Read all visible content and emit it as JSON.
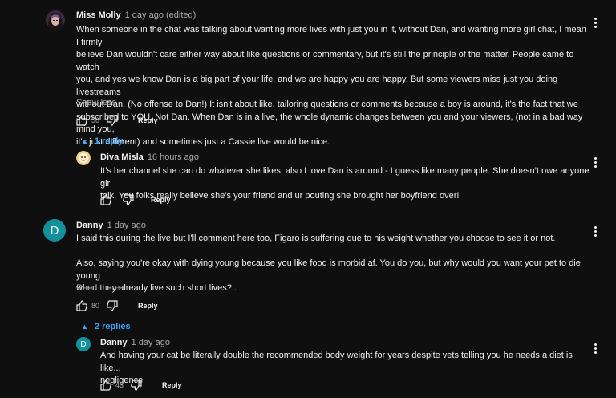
{
  "comments": [
    {
      "author": "Miss Molly",
      "time": "1 day ago (edited)",
      "text_lines": [
        "When someone in the chat was talking about wanting more lives with just you in it, without Dan, and wanting more girl chat, I mean I firmly",
        "believe Dan wouldn't care either way about like questions or commentary, but it's still the principle of the matter. People came to watch",
        "you, and yes we know Dan is a big part of your life, and we are happy you are happy. But some viewers miss just you doing livestreams",
        "without Dan. (No offense to Dan!) It isn't about like, tailoring questions or comments because a boy is around, it's the fact that we",
        "subscribed to YOU. Not Dan. When Dan is in a live, the whole dynamic changes between you and your viewers, (not in a bad way mind you,",
        "it's just different) and sometimes just a Cassie live would be nice."
      ],
      "expand_label": "Show less",
      "likes": "50",
      "reply_label": "Reply",
      "replies_toggle": "1 reply"
    },
    {
      "author": "Diva Misla",
      "time": "16 hours ago",
      "text_lines": [
        "It’s her channel she can do whatever she likes. also I love Dan is around - I guess like many people. She doesn’t owe anyone girl",
        "talk. You folks really believe she’s your friend and ur pouting she brought her boyfriend over!"
      ],
      "likes": "",
      "reply_label": "Reply"
    },
    {
      "author": "Danny",
      "time": "1 day ago",
      "avatar_letter": "D",
      "text_lines": [
        "I said this during the live but I'll comment here too, Figaro is suffering due to his weight whether you choose to see it or not.",
        "",
        "Also, saying you're okay with dying young because you like food is morbid af.  You do you, but why would you want your pet to die young",
        "when they already live such short lives?.."
      ],
      "expand_label": "Read more",
      "likes": "80",
      "reply_label": "Reply",
      "replies_toggle": "2 replies"
    },
    {
      "author": "Danny",
      "time": "1 day ago",
      "avatar_letter": "D",
      "text_lines": [
        "And having your cat be literally double the recommended body weight for years despite vets telling you he needs a diet is like...",
        "negligence"
      ],
      "likes": "43",
      "reply_label": "Reply"
    }
  ],
  "colors": {
    "background": "#0f0f0f",
    "link_blue": "#3ea6ff",
    "danny_avatar": "#12919a"
  },
  "icons": {
    "like": "thumbs-up-icon",
    "dislike": "thumbs-down-icon",
    "more": "more-vert-icon",
    "caret": "caret-up-icon"
  }
}
